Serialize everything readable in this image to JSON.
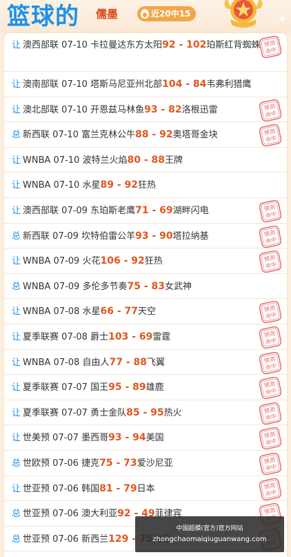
{
  "header": {
    "title": "篮球的",
    "expert_name": "儒墨",
    "streak": "近20中15",
    "colors": {
      "title": "#1e90e8",
      "expert": "#d84a1b",
      "streak_bg": "#f3a648"
    }
  },
  "stamp_text": [
    "预测",
    "命中"
  ],
  "rows": [
    {
      "type": "让",
      "league": "澳西部联",
      "date": "07-10",
      "home": "卡拉曼达东方太阳",
      "home_score": "92",
      "sep": "-",
      "away_score": "102",
      "away": "珀斯红背蜘蛛",
      "hit": true,
      "wrap": true
    },
    {
      "type": "让",
      "league": "澳南部联",
      "date": "07-10",
      "home": "塔斯马尼亚州北部",
      "home_score": "104",
      "sep": "-",
      "away_score": "84",
      "away": "韦弗利猎鹰",
      "hit": false
    },
    {
      "type": "让",
      "league": "澳北部联",
      "date": "07-10",
      "home": "开恩兹马林鱼",
      "home_score": "93",
      "sep": "-",
      "away_score": "82",
      "away": "洛根迅雷",
      "hit": true
    },
    {
      "type": "总",
      "league": "新西联",
      "date": "07-10",
      "home": "富兰克林公牛",
      "home_score": "88",
      "sep": "-",
      "away_score": "92",
      "away": "奥塔哥金块",
      "hit": true
    },
    {
      "type": "让",
      "league": "WNBA",
      "date": "07-10",
      "home": "波特兰火焰",
      "home_score": "80",
      "sep": "-",
      "away_score": "88",
      "away": "王牌",
      "hit": false
    },
    {
      "type": "让",
      "league": "WNBA",
      "date": "07-10",
      "home": "水星",
      "home_score": "89",
      "sep": "-",
      "away_score": "92",
      "away": "狂热",
      "hit": false
    },
    {
      "type": "让",
      "league": "澳西部联",
      "date": "07-09",
      "home": "东珀斯老鹰",
      "home_score": "71",
      "sep": "-",
      "away_score": "69",
      "away": "湖畔闪电",
      "hit": true
    },
    {
      "type": "总",
      "league": "新西联",
      "date": "07-09",
      "home": "坎特伯雷公羊",
      "home_score": "93",
      "sep": "-",
      "away_score": "90",
      "away": "塔拉纳基",
      "hit": true
    },
    {
      "type": "让",
      "league": "WNBA",
      "date": "07-09",
      "home": "火花",
      "home_score": "106",
      "sep": "-",
      "away_score": "92",
      "away": "狂热",
      "hit": true
    },
    {
      "type": "总",
      "league": "WNBA",
      "date": "07-09",
      "home": "多伦多节奏",
      "home_score": "75",
      "sep": "-",
      "away_score": "83",
      "away": "女武神",
      "hit": false
    },
    {
      "type": "让",
      "league": "WNBA",
      "date": "07-08",
      "home": "水星",
      "home_score": "66",
      "sep": "-",
      "away_score": "77",
      "away": "天空",
      "hit": true
    },
    {
      "type": "让",
      "league": "夏季联赛",
      "date": "07-08",
      "home": "爵士",
      "home_score": "103",
      "sep": "-",
      "away_score": "69",
      "away": "雷霆",
      "hit": true
    },
    {
      "type": "让",
      "league": "WNBA",
      "date": "07-08",
      "home": "自由人",
      "home_score": "77",
      "sep": "-",
      "away_score": "88",
      "away": "飞翼",
      "hit": true
    },
    {
      "type": "让",
      "league": "夏季联赛",
      "date": "07-07",
      "home": "国王",
      "home_score": "95",
      "sep": "-",
      "away_score": "89",
      "away": "雄鹿",
      "hit": true
    },
    {
      "type": "让",
      "league": "夏季联赛",
      "date": "07-07",
      "home": "勇士金队",
      "home_score": "85",
      "sep": "-",
      "away_score": "95",
      "away": "热火",
      "hit": true
    },
    {
      "type": "让",
      "league": "世美预",
      "date": "07-07",
      "home": "墨西哥",
      "home_score": "93",
      "sep": "-",
      "away_score": "94",
      "away": "美国",
      "hit": true
    },
    {
      "type": "总",
      "league": "世欧预",
      "date": "07-06",
      "home": "捷克",
      "home_score": "75",
      "sep": "-",
      "away_score": "73",
      "away": "爱沙尼亚",
      "hit": true
    },
    {
      "type": "让",
      "league": "世亚预",
      "date": "07-06",
      "home": "韩国",
      "home_score": "81",
      "sep": "-",
      "away_score": "79",
      "away": "日本",
      "hit": true
    },
    {
      "type": "总",
      "league": "世亚预",
      "date": "07-06",
      "home": "澳大利亚",
      "home_score": "92",
      "sep": "-",
      "away_score": "49",
      "away": "菲律宾",
      "hit": true
    },
    {
      "type": "总",
      "league": "世亚预",
      "date": "07-06",
      "home": "新西兰",
      "home_score": "129",
      "sep": "-",
      "away_score": "75",
      "away": "约旦",
      "hit": true
    }
  ],
  "watermark": {
    "line1": "中国超模(官方)官方网站",
    "line2": "zhongchaomaiqiuguanwang.com"
  }
}
